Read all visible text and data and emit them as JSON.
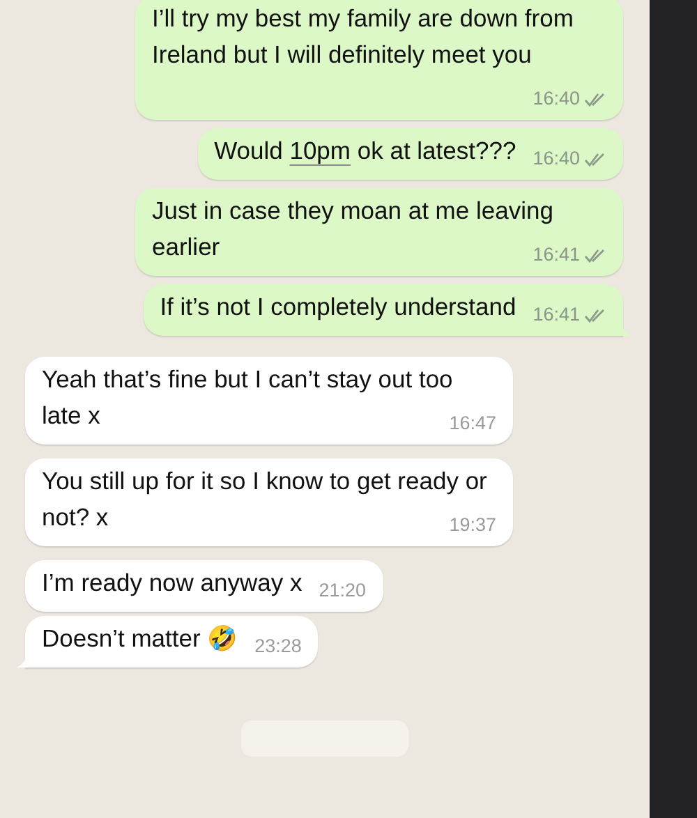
{
  "messages": [
    {
      "kind": "sent",
      "parts": [
        {
          "text": "I’ll try my best my family are down from Ireland but I will definitely meet you"
        }
      ],
      "time": "16:40",
      "read": false,
      "tail": false
    },
    {
      "kind": "sent",
      "parts": [
        {
          "text": "Would "
        },
        {
          "text": "10pm",
          "kind": "link"
        },
        {
          "text": " ok at latest???"
        }
      ],
      "time": "16:40",
      "read": false,
      "tail": false
    },
    {
      "kind": "sent",
      "parts": [
        {
          "text": "Just in case they moan at me leaving earlier"
        }
      ],
      "time": "16:41",
      "read": false,
      "tail": false
    },
    {
      "kind": "sent",
      "parts": [
        {
          "text": "If it’s not I completely understand"
        }
      ],
      "time": "16:41",
      "read": false,
      "tail": true
    },
    {
      "kind": "received",
      "parts": [
        {
          "text": "Yeah that’s fine but I can’t stay out too late x"
        }
      ],
      "time": "16:47",
      "tail": false
    },
    {
      "kind": "received",
      "parts": [
        {
          "text": "You still up for it so I know to get ready or not? x"
        }
      ],
      "time": "19:37",
      "tail": false
    },
    {
      "kind": "received",
      "parts": [
        {
          "text": "I’m ready now anyway x"
        }
      ],
      "time": "21:20",
      "tail": false
    },
    {
      "kind": "received",
      "parts": [
        {
          "text": "Doesn’t matter 🤣"
        }
      ],
      "time": "23:28",
      "tail": true
    }
  ]
}
